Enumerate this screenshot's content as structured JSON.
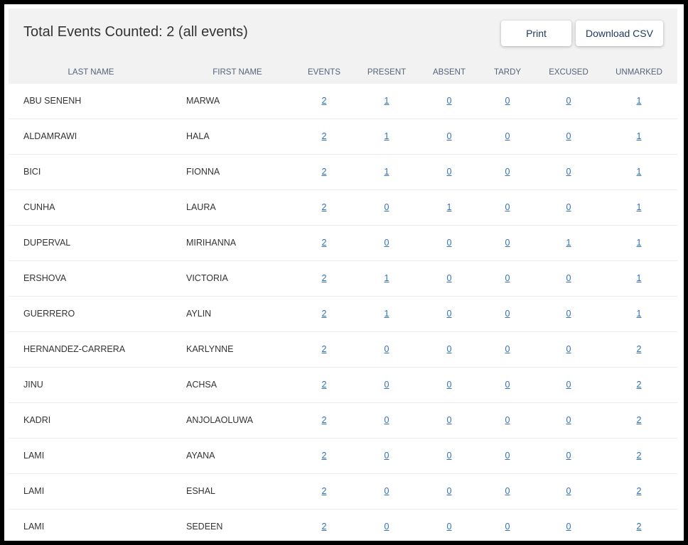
{
  "report": {
    "title": "Total Events Counted: 2 (all events)"
  },
  "actions": {
    "print_label": "Print",
    "csv_label": "Download CSV"
  },
  "columns": [
    "LAST NAME",
    "FIRST NAME",
    "EVENTS",
    "PRESENT",
    "ABSENT",
    "TARDY",
    "EXCUSED",
    "UNMARKED"
  ],
  "rows": [
    {
      "last": "ABU SENENH",
      "first": "MARWA",
      "events": "2",
      "present": "1",
      "absent": "0",
      "tardy": "0",
      "excused": "0",
      "unmarked": "1"
    },
    {
      "last": "ALDAMRAWI",
      "first": "HALA",
      "events": "2",
      "present": "1",
      "absent": "0",
      "tardy": "0",
      "excused": "0",
      "unmarked": "1"
    },
    {
      "last": "BICI",
      "first": "FIONNA",
      "events": "2",
      "present": "1",
      "absent": "0",
      "tardy": "0",
      "excused": "0",
      "unmarked": "1"
    },
    {
      "last": "CUNHA",
      "first": "LAURA",
      "events": "2",
      "present": "0",
      "absent": "1",
      "tardy": "0",
      "excused": "0",
      "unmarked": "1"
    },
    {
      "last": "DUPERVAL",
      "first": "MIRIHANNA",
      "events": "2",
      "present": "0",
      "absent": "0",
      "tardy": "0",
      "excused": "1",
      "unmarked": "1"
    },
    {
      "last": "ERSHOVA",
      "first": "VICTORIA",
      "events": "2",
      "present": "1",
      "absent": "0",
      "tardy": "0",
      "excused": "0",
      "unmarked": "1"
    },
    {
      "last": "GUERRERO",
      "first": "AYLIN",
      "events": "2",
      "present": "1",
      "absent": "0",
      "tardy": "0",
      "excused": "0",
      "unmarked": "1"
    },
    {
      "last": "HERNANDEZ-CARRERA",
      "first": "KARLYNNE",
      "events": "2",
      "present": "0",
      "absent": "0",
      "tardy": "0",
      "excused": "0",
      "unmarked": "2"
    },
    {
      "last": "JINU",
      "first": "ACHSA",
      "events": "2",
      "present": "0",
      "absent": "0",
      "tardy": "0",
      "excused": "0",
      "unmarked": "2"
    },
    {
      "last": "KADRI",
      "first": "ANJOLAOLUWA",
      "events": "2",
      "present": "0",
      "absent": "0",
      "tardy": "0",
      "excused": "0",
      "unmarked": "2"
    },
    {
      "last": "LAMI",
      "first": "AYANA",
      "events": "2",
      "present": "0",
      "absent": "0",
      "tardy": "0",
      "excused": "0",
      "unmarked": "2"
    },
    {
      "last": "LAMI",
      "first": "ESHAL",
      "events": "2",
      "present": "0",
      "absent": "0",
      "tardy": "0",
      "excused": "0",
      "unmarked": "2"
    },
    {
      "last": "LAMI",
      "first": "SEDEEN",
      "events": "2",
      "present": "0",
      "absent": "0",
      "tardy": "0",
      "excused": "0",
      "unmarked": "2"
    }
  ],
  "colors": {
    "header_bg": "#f2f2f2",
    "link": "#2f6fbd",
    "text": "#333333",
    "column_header": "#55627a"
  }
}
